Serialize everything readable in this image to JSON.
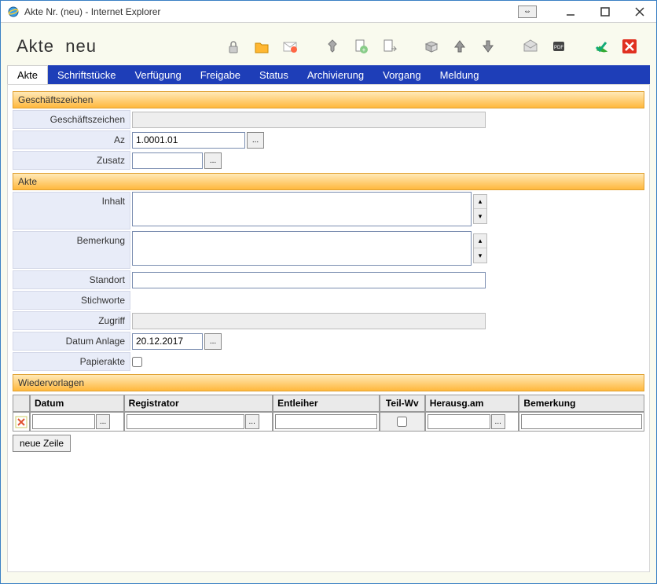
{
  "window": {
    "title": "Akte Nr. (neu) - Internet Explorer"
  },
  "page": {
    "title_a": "Akte",
    "title_b": "neu"
  },
  "tabs": {
    "akte": "Akte",
    "schriftstuecke": "Schriftstücke",
    "verfuegung": "Verfügung",
    "freigabe": "Freigabe",
    "status": "Status",
    "archivierung": "Archivierung",
    "vorgang": "Vorgang",
    "meldung": "Meldung"
  },
  "sections": {
    "gz": "Geschäftszeichen",
    "akte": "Akte",
    "wiedervorlagen": "Wiedervorlagen"
  },
  "labels": {
    "gz": "Geschäftszeichen",
    "az": "Az",
    "zusatz": "Zusatz",
    "inhalt": "Inhalt",
    "bemerkung": "Bemerkung",
    "standort": "Standort",
    "stichworte": "Stichworte",
    "zugriff": "Zugriff",
    "datum_anlage": "Datum Anlage",
    "papierakte": "Papierakte"
  },
  "values": {
    "gz": "",
    "az": "1.0001.01",
    "zusatz": "",
    "inhalt": "",
    "bemerkung": "",
    "standort": "",
    "stichworte": "",
    "zugriff": "",
    "datum_anlage": "20.12.2017",
    "papierakte": false
  },
  "lookup_label": "...",
  "wiedervorlagen": {
    "headers": {
      "datum": "Datum",
      "registrator": "Registrator",
      "entleiher": "Entleiher",
      "teilwv": "Teil-Wv",
      "herausg": "Herausg.am",
      "bemerkung": "Bemerkung"
    },
    "row": {
      "datum": "",
      "registrator": "",
      "entleiher": "",
      "teilwv": false,
      "herausg": "",
      "bemerkung": ""
    },
    "new_row_btn": "neue Zeile"
  },
  "toolbar_icons": {
    "lock": "lock-icon",
    "folder": "folder-icon",
    "mail": "mail-icon",
    "pin": "pin-icon",
    "doc_add": "document-add-icon",
    "doc_send": "document-send-icon",
    "box": "box-icon",
    "up": "arrow-up-icon",
    "down": "arrow-down-icon",
    "envelope": "envelope-icon",
    "pdf": "pdf-icon",
    "check": "check-icon",
    "close": "close-icon"
  }
}
